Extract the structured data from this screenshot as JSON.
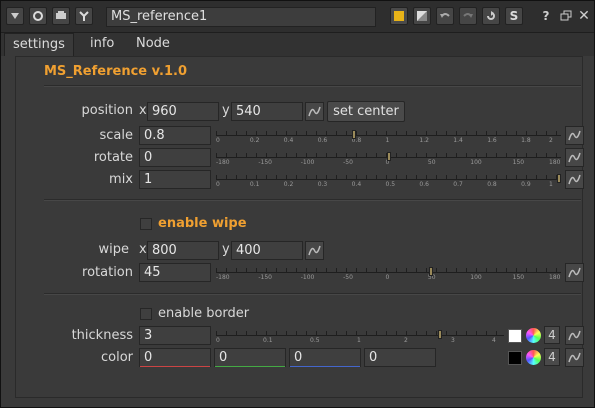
{
  "window": {
    "node_name": "MS_reference1",
    "help": "?",
    "s_label": "S"
  },
  "tabs": [
    "settings",
    "info",
    "Node"
  ],
  "header": "MS_Reference v.1.0",
  "position": {
    "label": "position",
    "x_label": "x",
    "x": "960",
    "y_label": "y",
    "y": "540",
    "button": "set center"
  },
  "scale": {
    "label": "scale",
    "value": "0.8",
    "ticks": [
      "0",
      "0.2",
      "0.4",
      "0.6",
      "0.8",
      "1",
      "1.2",
      "1.4",
      "1.6",
      "1.8",
      "2"
    ],
    "knob": 0.4
  },
  "rotate": {
    "label": "rotate",
    "value": "0",
    "ticks": [
      "-180",
      "-150",
      "-100",
      "-50",
      "0",
      "50",
      "100",
      "150",
      "180"
    ],
    "knob": 0.5
  },
  "mix": {
    "label": "mix",
    "value": "1",
    "ticks": [
      "0",
      "0.1",
      "0.2",
      "0.3",
      "0.4",
      "0.5",
      "0.6",
      "0.7",
      "0.8",
      "0.9",
      "1"
    ],
    "knob": 1.0
  },
  "wipe_toggle": {
    "label": "enable wipe",
    "checked": false
  },
  "wipe": {
    "label": "wipe",
    "x_label": "x",
    "x": "800",
    "y_label": "y",
    "y": "400"
  },
  "rotation": {
    "label": "rotation",
    "value": "45",
    "ticks": [
      "-180",
      "-150",
      "-100",
      "-50",
      "0",
      "50",
      "100",
      "150",
      "180"
    ],
    "knob": 0.625
  },
  "border_toggle": {
    "label": "enable border",
    "checked": false
  },
  "thickness": {
    "label": "thickness",
    "value": "3",
    "ticks": [
      "0",
      "0.1",
      "0.5",
      "1",
      "2",
      "3",
      "4"
    ],
    "knob": 0.78,
    "channels": "4"
  },
  "color": {
    "label": "color",
    "values": [
      "0",
      "0",
      "0",
      "0"
    ],
    "channels": "4"
  },
  "colors": {
    "accent": "#f0a031",
    "red": "#c44",
    "green": "#4a4",
    "blue": "#46c"
  }
}
